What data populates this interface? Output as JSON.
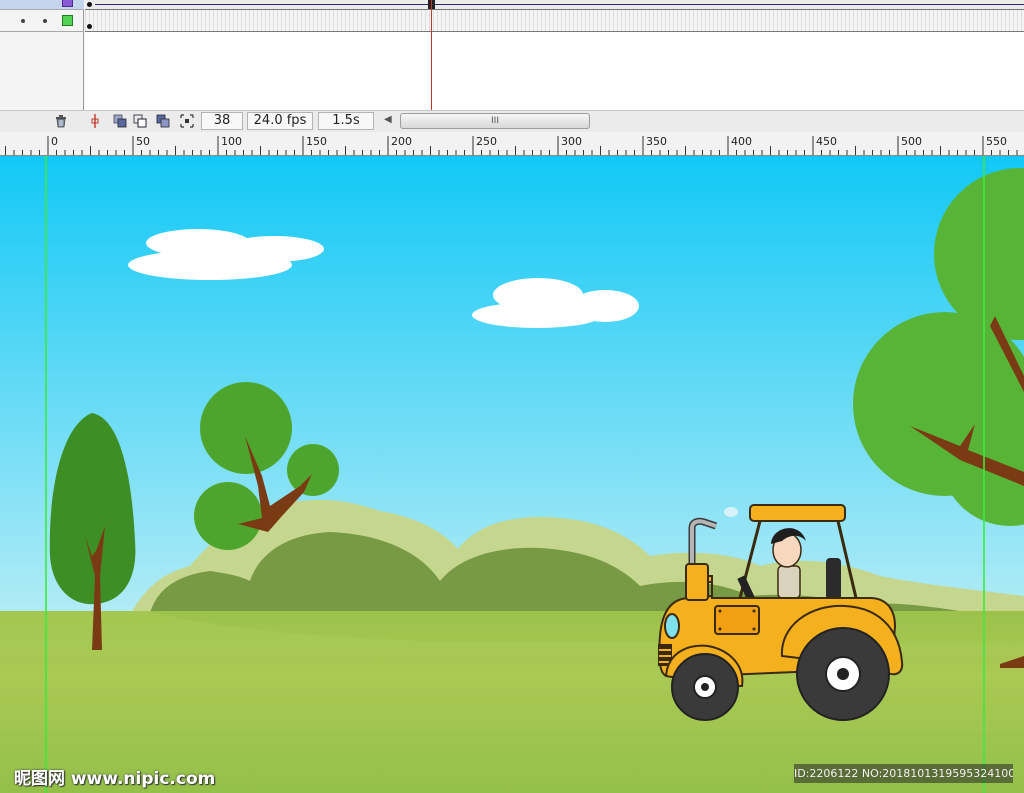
{
  "timeline": {
    "current_frame": "38",
    "frame_rate": "24.0 fps",
    "elapsed_time": "1.5s",
    "scroll_grip": "III"
  },
  "ruler": {
    "ticks": [
      "0",
      "50",
      "100",
      "150",
      "200",
      "250",
      "300",
      "350",
      "400",
      "450",
      "500",
      "550"
    ]
  },
  "icons": {
    "trash": "trash-icon",
    "onion_center": "center-frame-icon",
    "onion_skin": "onion-skin-icon",
    "onion_outlines": "onion-skin-outlines-icon",
    "edit_multiple": "edit-multiple-frames-icon",
    "onion_markers": "modify-onion-markers-icon"
  },
  "colors": {
    "sky_top": "#12c8f6",
    "sky_bottom": "#b6ecf6",
    "grass": "#9cc24c",
    "car_yellow": "#f5b01e",
    "guide_green": "#3ee83e",
    "playhead_red": "#c0392b"
  },
  "watermark": {
    "site": "昵图网 www.nipic.com",
    "id_text": "ID:2206122 NO:20181013195953241000"
  }
}
